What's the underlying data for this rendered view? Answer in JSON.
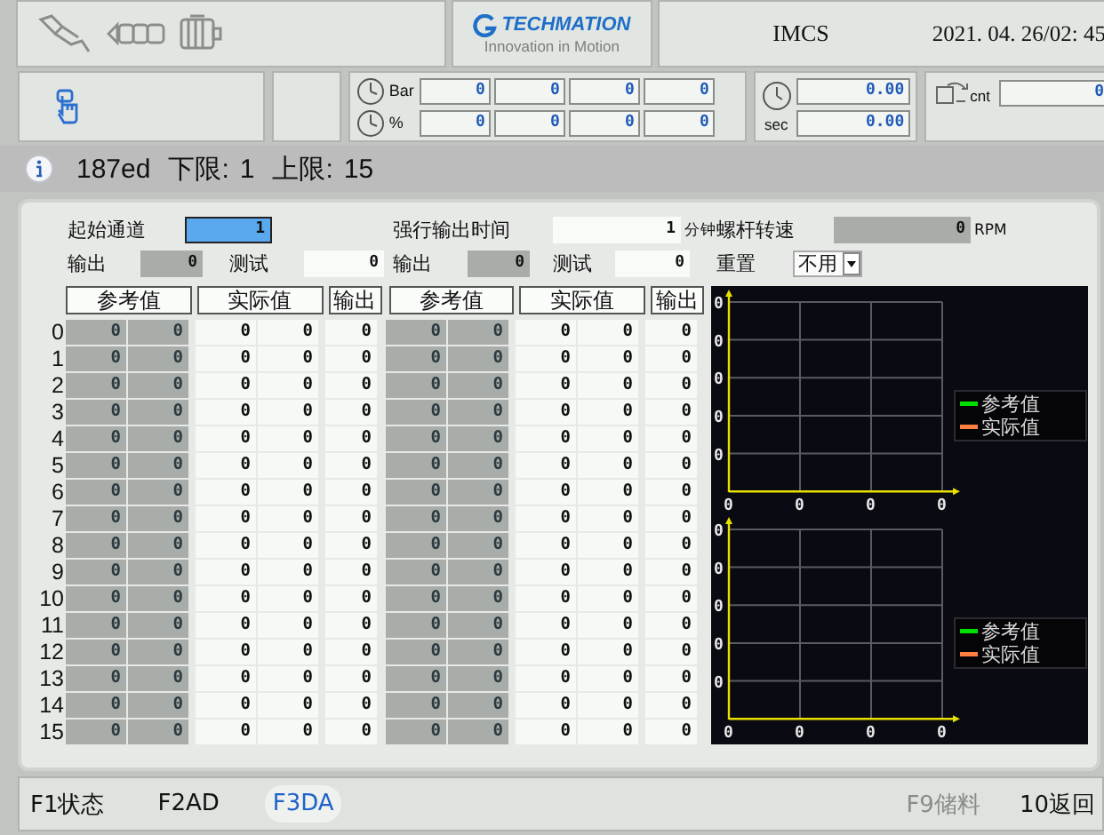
{
  "header": {
    "brand": "TECHMATION",
    "slogan": "Innovation in Motion",
    "system": "IMCS",
    "datetime": "2021. 04. 26/02: 45"
  },
  "gauges": {
    "rows": [
      {
        "unit": "Bar",
        "values": [
          "0",
          "0",
          "0",
          "0"
        ]
      },
      {
        "unit": "%",
        "values": [
          "0",
          "0",
          "0",
          "0"
        ]
      }
    ],
    "timer": {
      "unit": "sec",
      "values": [
        "0.00",
        "0.00"
      ]
    },
    "counter": {
      "unit": "cnt",
      "value": "0"
    }
  },
  "info": {
    "code": "187ed",
    "lower_label": "下限:",
    "lower": "1",
    "upper_label": "上限:",
    "upper": "15"
  },
  "form": [
    [
      {
        "kind": "field",
        "label": "起始通道",
        "value": "1",
        "editable": true,
        "focused": true
      },
      {
        "kind": "field",
        "label": "强行输出时间",
        "value": "1",
        "unit": "分钟",
        "editable": true,
        "focused": false
      },
      {
        "kind": "field",
        "label": "螺杆转速",
        "value": "0",
        "unit": "RPM",
        "editable": false,
        "focused": false
      }
    ],
    [
      {
        "kind": "field",
        "label": "输出",
        "value": "0",
        "editable": false,
        "focused": false
      },
      {
        "kind": "field",
        "label": "测试",
        "value": "0",
        "editable": true,
        "focused": false
      },
      {
        "kind": "field",
        "label": "输出",
        "value": "0",
        "editable": false,
        "focused": false
      },
      {
        "kind": "field",
        "label": "测试",
        "value": "0",
        "editable": true,
        "focused": false
      },
      {
        "kind": "dropdown",
        "label": "重置",
        "value": "不用"
      }
    ]
  ],
  "table": {
    "groups": [
      {
        "reference": "参考值",
        "actual": "实际值",
        "output": "输出"
      },
      {
        "reference": "参考值",
        "actual": "实际值",
        "output": "输出"
      }
    ],
    "rows": [
      {
        "index": "0",
        "cells": [
          "0",
          "0",
          "0",
          "0",
          "0",
          "0",
          "0",
          "0",
          "0",
          "0"
        ]
      },
      {
        "index": "1",
        "cells": [
          "0",
          "0",
          "0",
          "0",
          "0",
          "0",
          "0",
          "0",
          "0",
          "0"
        ]
      },
      {
        "index": "2",
        "cells": [
          "0",
          "0",
          "0",
          "0",
          "0",
          "0",
          "0",
          "0",
          "0",
          "0"
        ]
      },
      {
        "index": "3",
        "cells": [
          "0",
          "0",
          "0",
          "0",
          "0",
          "0",
          "0",
          "0",
          "0",
          "0"
        ]
      },
      {
        "index": "4",
        "cells": [
          "0",
          "0",
          "0",
          "0",
          "0",
          "0",
          "0",
          "0",
          "0",
          "0"
        ]
      },
      {
        "index": "5",
        "cells": [
          "0",
          "0",
          "0",
          "0",
          "0",
          "0",
          "0",
          "0",
          "0",
          "0"
        ]
      },
      {
        "index": "6",
        "cells": [
          "0",
          "0",
          "0",
          "0",
          "0",
          "0",
          "0",
          "0",
          "0",
          "0"
        ]
      },
      {
        "index": "7",
        "cells": [
          "0",
          "0",
          "0",
          "0",
          "0",
          "0",
          "0",
          "0",
          "0",
          "0"
        ]
      },
      {
        "index": "8",
        "cells": [
          "0",
          "0",
          "0",
          "0",
          "0",
          "0",
          "0",
          "0",
          "0",
          "0"
        ]
      },
      {
        "index": "9",
        "cells": [
          "0",
          "0",
          "0",
          "0",
          "0",
          "0",
          "0",
          "0",
          "0",
          "0"
        ]
      },
      {
        "index": "10",
        "cells": [
          "0",
          "0",
          "0",
          "0",
          "0",
          "0",
          "0",
          "0",
          "0",
          "0"
        ]
      },
      {
        "index": "11",
        "cells": [
          "0",
          "0",
          "0",
          "0",
          "0",
          "0",
          "0",
          "0",
          "0",
          "0"
        ]
      },
      {
        "index": "12",
        "cells": [
          "0",
          "0",
          "0",
          "0",
          "0",
          "0",
          "0",
          "0",
          "0",
          "0"
        ]
      },
      {
        "index": "13",
        "cells": [
          "0",
          "0",
          "0",
          "0",
          "0",
          "0",
          "0",
          "0",
          "0",
          "0"
        ]
      },
      {
        "index": "14",
        "cells": [
          "0",
          "0",
          "0",
          "0",
          "0",
          "0",
          "0",
          "0",
          "0",
          "0"
        ]
      },
      {
        "index": "15",
        "cells": [
          "0",
          "0",
          "0",
          "0",
          "0",
          "0",
          "0",
          "0",
          "0",
          "0"
        ]
      }
    ]
  },
  "charts": [
    {
      "y_labels": [
        "0",
        "0",
        "0",
        "0",
        "0"
      ],
      "x_labels": [
        "0",
        "0",
        "0",
        "0"
      ],
      "legend": [
        {
          "label": "参考值",
          "color": "#00e000"
        },
        {
          "label": "实际值",
          "color": "#ff7f40"
        }
      ]
    },
    {
      "y_labels": [
        "0",
        "0",
        "0",
        "0",
        "0"
      ],
      "x_labels": [
        "0",
        "0",
        "0",
        "0"
      ],
      "legend": [
        {
          "label": "参考值",
          "color": "#00e000"
        },
        {
          "label": "实际值",
          "color": "#ff7f40"
        }
      ]
    }
  ],
  "function_keys": [
    {
      "label": "F1状态",
      "selected": false,
      "disabled": false
    },
    {
      "label": "F2AD",
      "selected": false,
      "disabled": false
    },
    {
      "label": "F3DA",
      "selected": true,
      "disabled": false
    },
    {
      "label": "F9储料",
      "selected": false,
      "disabled": true
    },
    {
      "label": "10返回",
      "selected": false,
      "disabled": false
    }
  ]
}
